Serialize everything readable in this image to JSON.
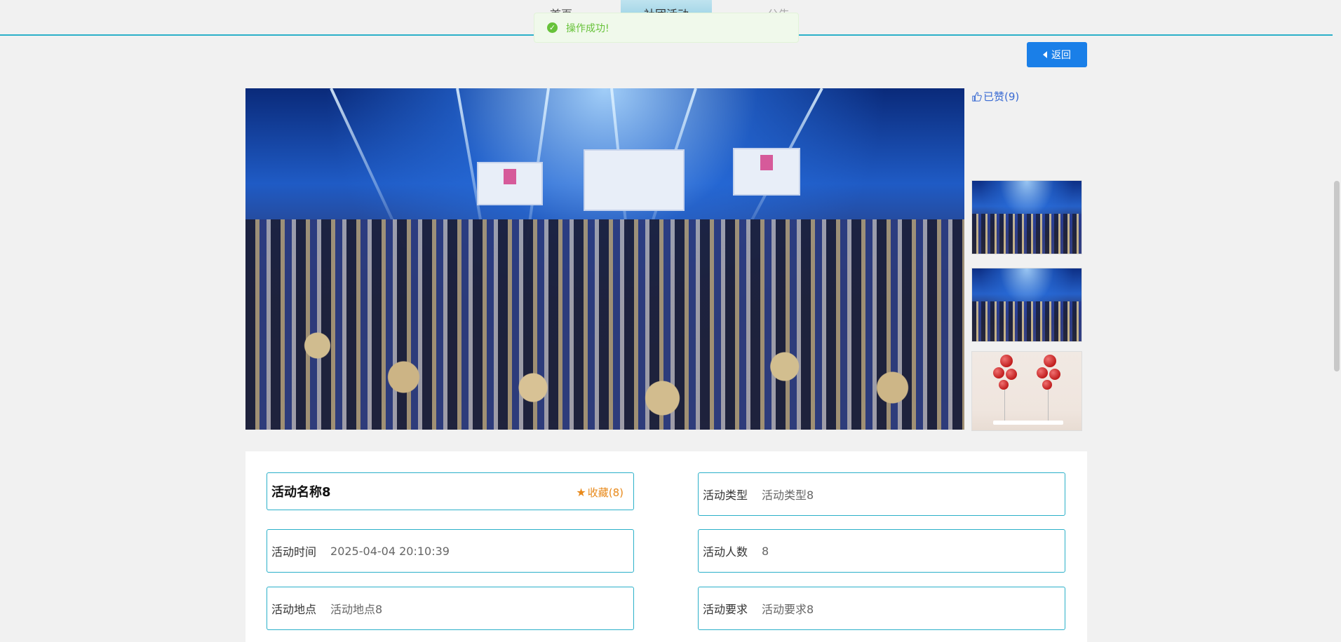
{
  "nav": {
    "tabs": [
      "首页",
      "社团活动",
      "公告"
    ]
  },
  "toast": {
    "message": "操作成功!",
    "icon": "check-circle-icon",
    "color": "#67c23a"
  },
  "back_button": {
    "label": "返回",
    "color": "#1a7fe8"
  },
  "like": {
    "label": "已赞(9)",
    "icon": "thumbs-up-icon"
  },
  "gallery": {
    "thumbnails": [
      "event-photo",
      "event-photo",
      "balloon-photo"
    ]
  },
  "activity": {
    "name": "活动名称8",
    "favorite_label": "收藏(8)",
    "fields": {
      "type": {
        "label": "活动类型",
        "value": "活动类型8"
      },
      "time": {
        "label": "活动时间",
        "value": "2025-04-04 20:10:39"
      },
      "count": {
        "label": "活动人数",
        "value": "8"
      },
      "location": {
        "label": "活动地点",
        "value": "活动地点8"
      },
      "requirement": {
        "label": "活动要求",
        "value": "活动要求8"
      }
    }
  },
  "colors": {
    "accent": "#2bb0c9",
    "favorite": "#e8891a",
    "like": "#3a6bd3"
  }
}
